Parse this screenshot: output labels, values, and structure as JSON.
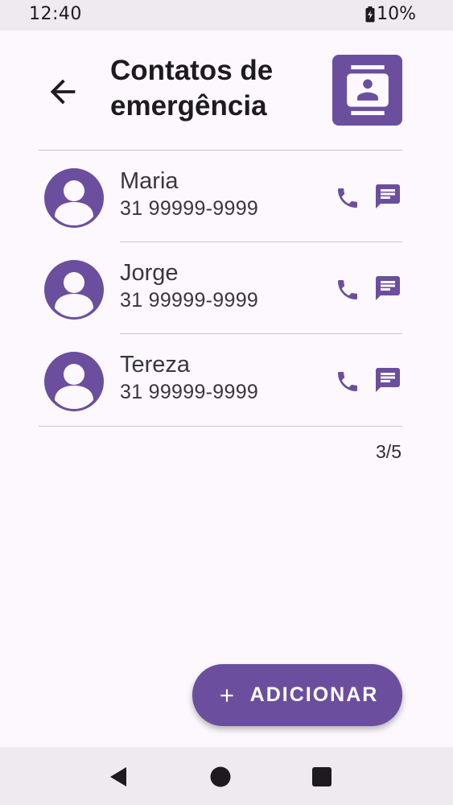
{
  "status_bar": {
    "time": "12:40",
    "battery": "10%"
  },
  "header": {
    "title": "Contatos de emergência",
    "back_icon": "arrow-left-icon",
    "badge_icon": "contact-card-icon"
  },
  "contacts": [
    {
      "name": "Maria",
      "phone": "31 99999-9999"
    },
    {
      "name": "Jorge",
      "phone": "31 99999-9999"
    },
    {
      "name": "Tereza",
      "phone": "31 99999-9999"
    }
  ],
  "counter": "3/5",
  "fab": {
    "label": "ADICIONAR",
    "icon": "plus-icon"
  },
  "nav": {
    "back_icon": "nav-back-icon",
    "home_icon": "nav-home-icon",
    "recents_icon": "nav-recents-icon"
  },
  "colors": {
    "accent": "#6b4f9e",
    "background": "#fcf8fd",
    "bars": "#eeeaef"
  }
}
